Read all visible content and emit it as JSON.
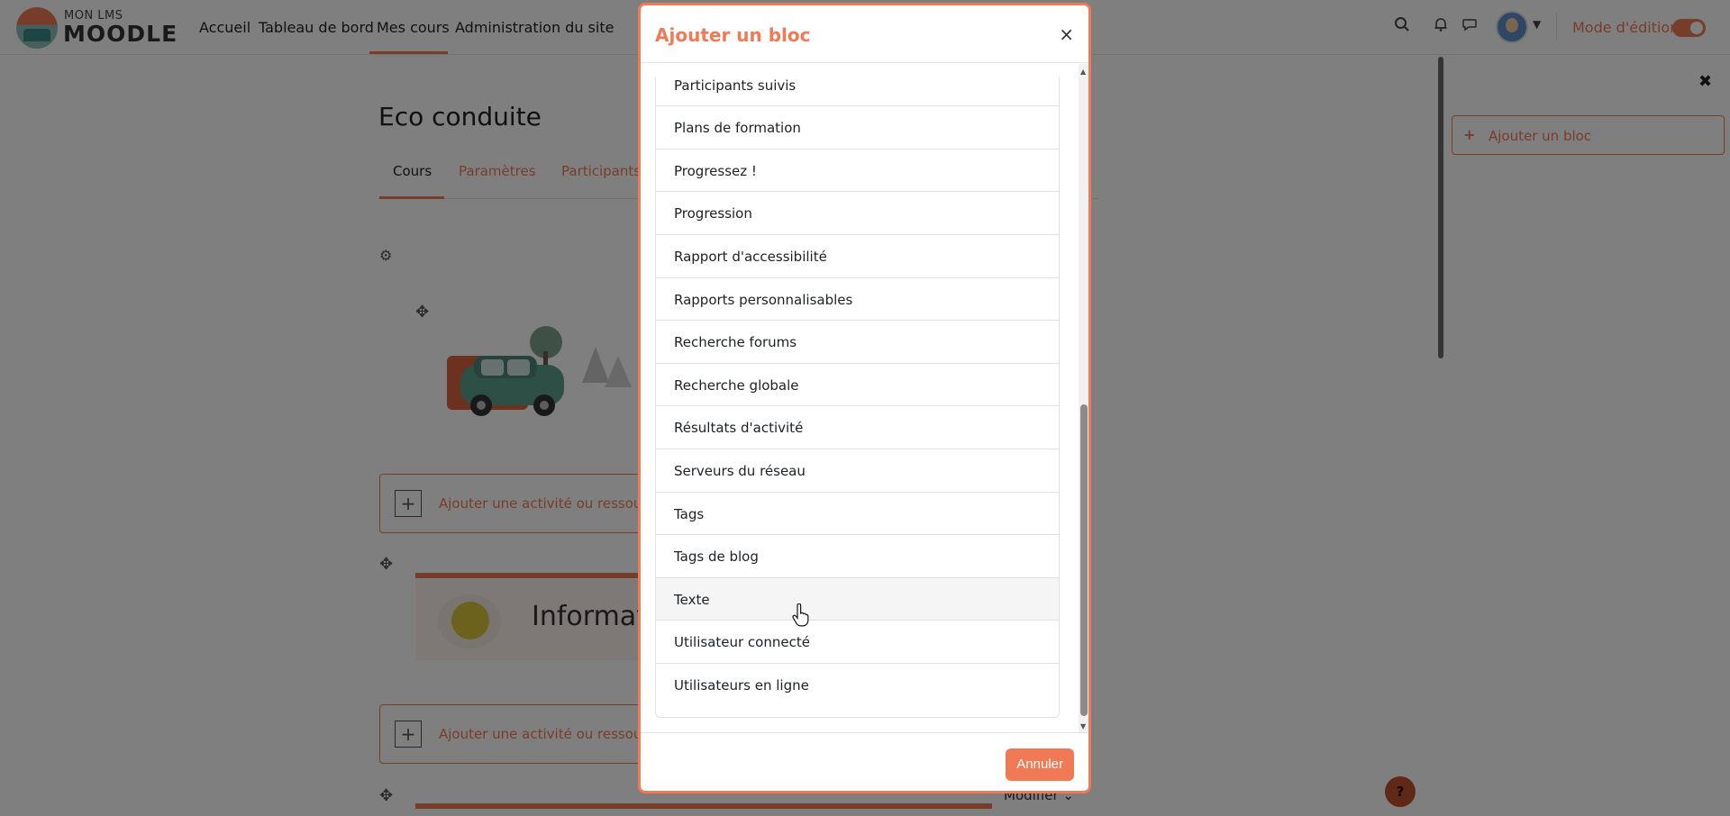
{
  "brand": {
    "small": "MON LMS",
    "big": "MOODLE"
  },
  "nav": {
    "links": [
      "Accueil",
      "Tableau de bord",
      "Mes cours",
      "Administration du site"
    ],
    "edit_mode_label": "Mode d'édition",
    "edit_mode_on": true
  },
  "course": {
    "title": "Eco conduite",
    "tabs": [
      "Cours",
      "Paramètres",
      "Participants"
    ],
    "add_activity_label": "Ajouter une activité ou ressource",
    "section_title": "Informati",
    "modify_label": "Modifier"
  },
  "drawer": {
    "add_block_label": "Ajouter un bloc"
  },
  "help": {
    "label": "?"
  },
  "modal": {
    "title": "Ajouter un bloc",
    "close_label": "×",
    "items": [
      "Participants suivis",
      "Plans de formation",
      "Progressez !",
      "Progression",
      "Rapport d'accessibilité",
      "Rapports personnalisables",
      "Recherche forums",
      "Recherche globale",
      "Résultats d'activité",
      "Serveurs du réseau",
      "Tags",
      "Tags de blog",
      "Texte",
      "Utilisateur connecté",
      "Utilisateurs en ligne"
    ],
    "hovered_item": "Texte",
    "cancel_label": "Annuler"
  },
  "colors": {
    "accent": "#f07a55",
    "help": "#c0502f"
  },
  "icons": {
    "search": "search-icon",
    "bell": "bell-icon",
    "chat": "chat-icon",
    "gear": "gear-icon",
    "move": "move-icon",
    "plus": "plus-icon",
    "close": "close-icon"
  }
}
